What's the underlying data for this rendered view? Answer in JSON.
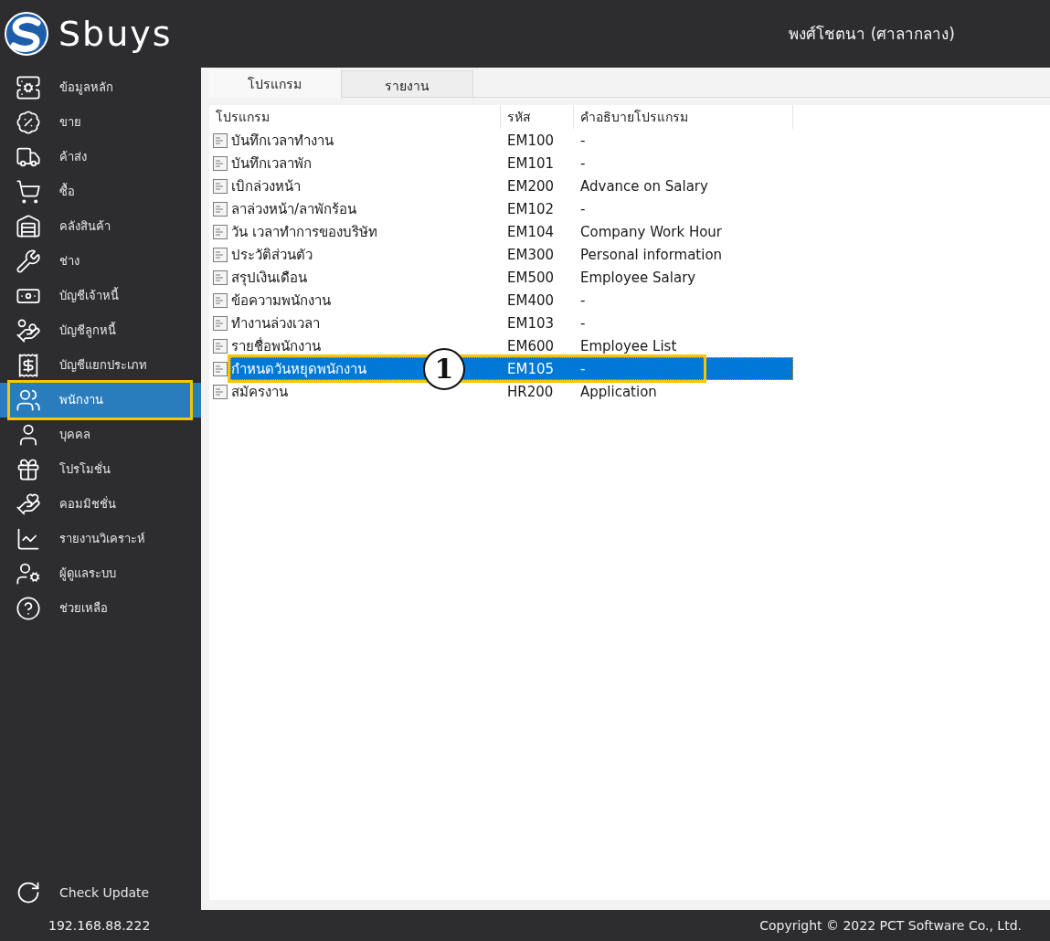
{
  "header": {
    "logo": "Sbuys",
    "user": "พงศ์โชตนา (ศาลากลาง)"
  },
  "sidebar": {
    "items": [
      {
        "label": "ข้อมูลหลัก",
        "selected": false,
        "highlighted": false
      },
      {
        "label": "ขาย",
        "selected": false,
        "highlighted": false
      },
      {
        "label": "ค้าส่ง",
        "selected": false,
        "highlighted": false
      },
      {
        "label": "ซื้อ",
        "selected": false,
        "highlighted": false
      },
      {
        "label": "คลังสินค้า",
        "selected": false,
        "highlighted": false
      },
      {
        "label": "ช่าง",
        "selected": false,
        "highlighted": false
      },
      {
        "label": "บัญชีเจ้าหนี้",
        "selected": false,
        "highlighted": false
      },
      {
        "label": "บัญชีลูกหนี้",
        "selected": false,
        "highlighted": false
      },
      {
        "label": "บัญชีแยกประเภท",
        "selected": false,
        "highlighted": false
      },
      {
        "label": "พนักงาน",
        "selected": true,
        "highlighted": true
      },
      {
        "label": "บุคคล",
        "selected": false,
        "highlighted": false
      },
      {
        "label": "โปรโมชั่น",
        "selected": false,
        "highlighted": false
      },
      {
        "label": "คอมมิชชั่น",
        "selected": false,
        "highlighted": false
      },
      {
        "label": "รายงานวิเคราะห์",
        "selected": false,
        "highlighted": false
      },
      {
        "label": "ผู้ดูแลระบบ",
        "selected": false,
        "highlighted": false
      },
      {
        "label": "ช่วยเหลือ",
        "selected": false,
        "highlighted": false
      }
    ],
    "check_update": "Check Update"
  },
  "tabs": [
    {
      "label": "โปรแกรม",
      "selected": true
    },
    {
      "label": "รายงาน",
      "selected": false
    }
  ],
  "table": {
    "columns": [
      "โปรแกรม",
      "รหัส",
      "คำอธิบายโปรแกรม"
    ],
    "rows": [
      {
        "program": "บันทึกเวลาทำงาน",
        "code": "EM100",
        "description": "-",
        "selected": false,
        "highlighted": false
      },
      {
        "program": "บันทึกเวลาพัก",
        "code": "EM101",
        "description": "-",
        "selected": false,
        "highlighted": false
      },
      {
        "program": "เบิกล่วงหน้า",
        "code": "EM200",
        "description": "Advance on Salary",
        "selected": false,
        "highlighted": false
      },
      {
        "program": "ลาล่วงหน้า/ลาพักร้อน",
        "code": "EM102",
        "description": "-",
        "selected": false,
        "highlighted": false
      },
      {
        "program": "วัน เวลาทำการของบริษัท",
        "code": "EM104",
        "description": "Company Work Hour",
        "selected": false,
        "highlighted": false
      },
      {
        "program": "ประวัติส่วนตัว",
        "code": "EM300",
        "description": "Personal information",
        "selected": false,
        "highlighted": false
      },
      {
        "program": "สรุปเงินเดือน",
        "code": "EM500",
        "description": "Employee Salary",
        "selected": false,
        "highlighted": false
      },
      {
        "program": "ข้อความพนักงาน",
        "code": "EM400",
        "description": "-",
        "selected": false,
        "highlighted": false
      },
      {
        "program": "ทำงานล่วงเวลา",
        "code": "EM103",
        "description": "-",
        "selected": false,
        "highlighted": false
      },
      {
        "program": "รายชื่อพนักงาน",
        "code": "EM600",
        "description": "Employee List",
        "selected": false,
        "highlighted": false
      },
      {
        "program": "กำหนดวันหยุดพนักงาน",
        "code": "EM105",
        "description": "-",
        "selected": true,
        "highlighted": true,
        "callout": "1"
      },
      {
        "program": "สมัครงาน",
        "code": "HR200",
        "description": "Application",
        "selected": false,
        "highlighted": false
      }
    ]
  },
  "status_bar": {
    "ip": "192.168.88.222",
    "copyright": "Copyright © 2022 PCT Software Co., Ltd."
  }
}
